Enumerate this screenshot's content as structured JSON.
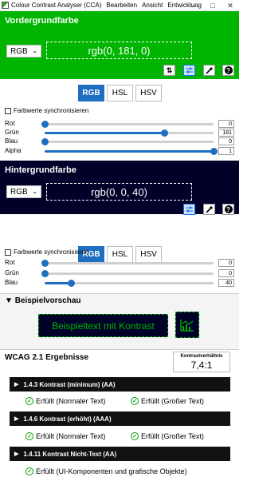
{
  "window": {
    "title": "Colour Contrast Analyser (CCA)",
    "menu": [
      "Bearbeiten",
      "Ansicht",
      "Entwicklung"
    ],
    "controls": [
      "—",
      "□",
      "✕"
    ]
  },
  "foreground": {
    "title": "Vordergrundfarbe",
    "format": "RGB",
    "value": "rgb(0, 181, 0)",
    "color": "#00b500",
    "tabs": [
      "RGB",
      "HSL",
      "HSV"
    ],
    "active_tab": "RGB",
    "sync_label": "Farbwerte synchronisieren",
    "sliders": [
      {
        "label": "Rot",
        "value": "0",
        "max": 255
      },
      {
        "label": "Grün",
        "value": "181",
        "max": 255
      },
      {
        "label": "Blau",
        "value": "0",
        "max": 255
      },
      {
        "label": "Alpha",
        "value": "1",
        "max": 1
      }
    ]
  },
  "background": {
    "title": "Hintergrundfarbe",
    "format": "RGB",
    "value": "rgb(0, 0, 40)",
    "color": "#000028",
    "tabs": [
      "RGB",
      "HSL",
      "HSV"
    ],
    "active_tab": "RGB",
    "sync_label": "Farbwerte synchronisieren",
    "sliders": [
      {
        "label": "Rot",
        "value": "0",
        "max": 255
      },
      {
        "label": "Grün",
        "value": "0",
        "max": 255
      },
      {
        "label": "Blau",
        "value": "40",
        "max": 255
      }
    ]
  },
  "preview": {
    "title": "Beispielvorschau",
    "sample_text": "Beispieltext mit Kontrast"
  },
  "wcag": {
    "title": "WCAG 2.1 Ergebnisse",
    "ratio_label": "Kontrastverhältnis",
    "ratio_value": "7,4:1",
    "criteria": [
      {
        "title": "1.4.3 Kontrast (minimum) (AA)",
        "results": [
          "Erfüllt (Normaler Text)",
          "Erfüllt (Großer Text)"
        ]
      },
      {
        "title": "1.4.6 Kontrast (erhöht) (AAA)",
        "results": [
          "Erfüllt (Normaler Text)",
          "Erfüllt (Großer Text)"
        ]
      },
      {
        "title": "1.4.11 Kontrast Nicht-Text (AA)",
        "results": [
          "Erfüllt (UI-Komponenten und grafische Objekte)"
        ]
      }
    ]
  },
  "icons": [
    "swap-icon",
    "sliders-icon",
    "eyedropper-icon",
    "help-icon",
    "chart-icon",
    "check-circle-icon"
  ]
}
